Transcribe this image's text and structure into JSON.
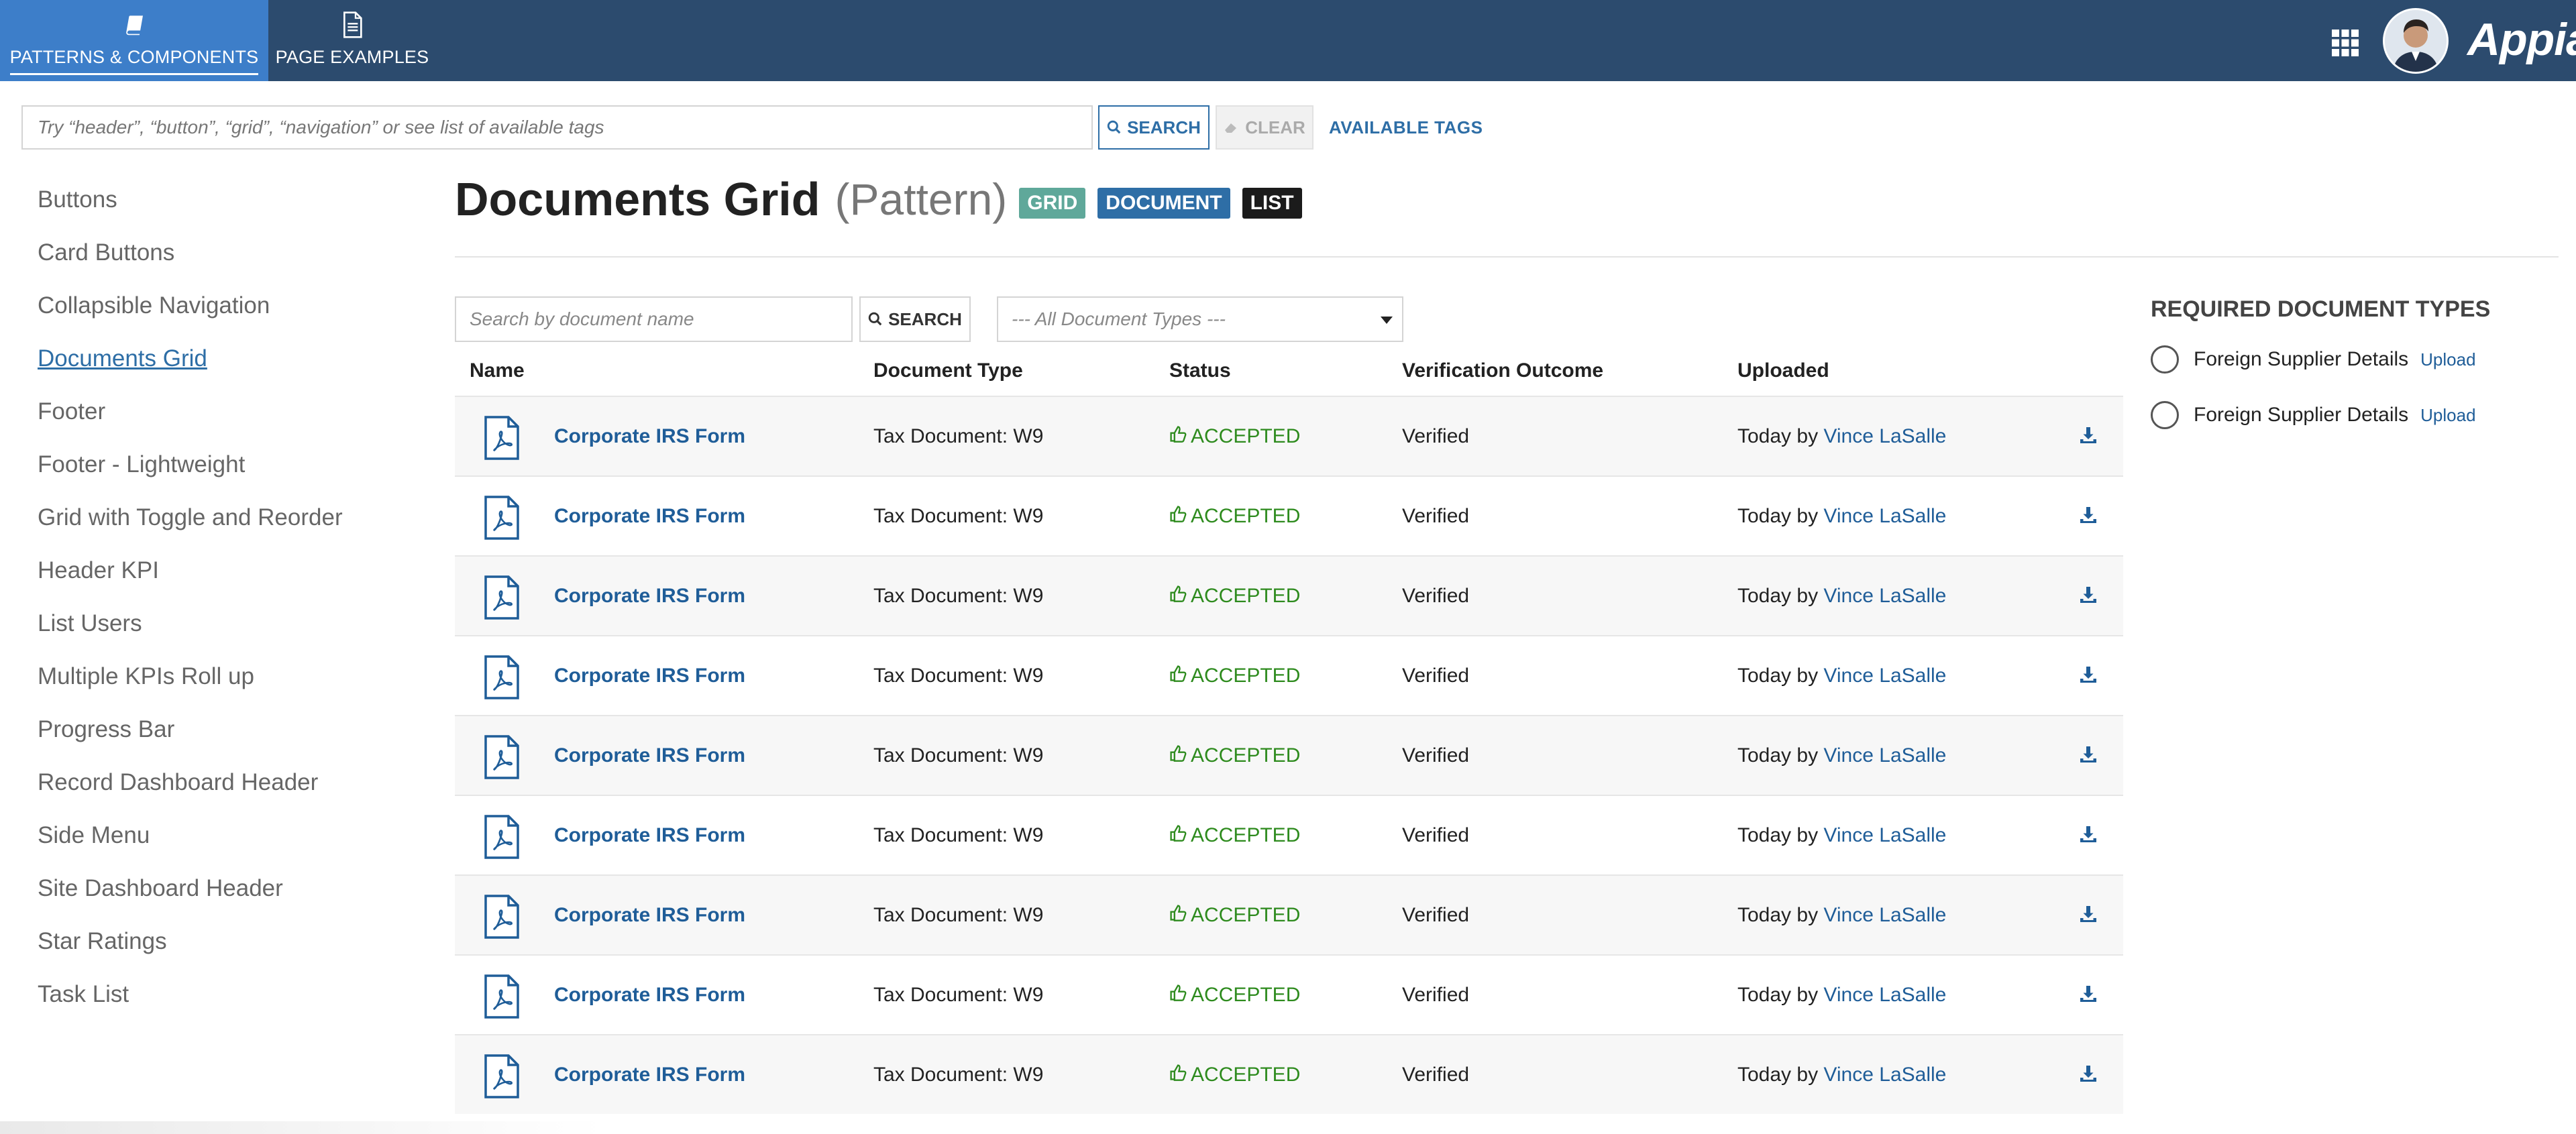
{
  "topnav": {
    "tabs": [
      {
        "label": "PATTERNS & COMPONENTS",
        "icon": "book-icon",
        "active": true
      },
      {
        "label": "PAGE EXAMPLES",
        "icon": "page-icon",
        "active": false
      }
    ],
    "logo": "Appian"
  },
  "tag_search": {
    "placeholder": "Try “header”, “button”, “grid”, “navigation” or see list of available tags",
    "search_label": "SEARCH",
    "clear_label": "CLEAR",
    "available_tags_label": "AVAILABLE TAGS"
  },
  "sidebar": {
    "items": [
      {
        "label": "Buttons"
      },
      {
        "label": "Card Buttons"
      },
      {
        "label": "Collapsible Navigation"
      },
      {
        "label": "Documents Grid",
        "active": true
      },
      {
        "label": "Footer"
      },
      {
        "label": "Footer - Lightweight"
      },
      {
        "label": "Grid with Toggle and Reorder"
      },
      {
        "label": "Header KPI"
      },
      {
        "label": "List Users"
      },
      {
        "label": "Multiple KPIs Roll up"
      },
      {
        "label": "Progress Bar"
      },
      {
        "label": "Record Dashboard Header"
      },
      {
        "label": "Side Menu"
      },
      {
        "label": "Site Dashboard Header"
      },
      {
        "label": "Star Ratings"
      },
      {
        "label": "Task List"
      }
    ]
  },
  "header": {
    "title": "Documents Grid",
    "subtitle": "(Pattern)",
    "tags": [
      {
        "label": "GRID",
        "color": "#5fa89a"
      },
      {
        "label": "DOCUMENT",
        "color": "#2e6ea6"
      },
      {
        "label": "LIST",
        "color": "#1b1b1b"
      }
    ]
  },
  "doc_search": {
    "placeholder": "Search by document name",
    "search_label": "SEARCH",
    "type_select_value": "--- All Document Types ---"
  },
  "grid": {
    "columns": [
      "Name",
      "Document Type",
      "Status",
      "Verification Outcome",
      "Uploaded"
    ],
    "rows": [
      {
        "name": "Corporate IRS Form",
        "type": "Tax Document: W9",
        "status": "ACCEPTED",
        "outcome": "Verified",
        "uploaded_prefix": "Today by",
        "user": "Vince LaSalle"
      },
      {
        "name": "Corporate IRS Form",
        "type": "Tax Document: W9",
        "status": "ACCEPTED",
        "outcome": "Verified",
        "uploaded_prefix": "Today by",
        "user": "Vince LaSalle"
      },
      {
        "name": "Corporate IRS Form",
        "type": "Tax Document: W9",
        "status": "ACCEPTED",
        "outcome": "Verified",
        "uploaded_prefix": "Today by",
        "user": "Vince LaSalle"
      },
      {
        "name": "Corporate IRS Form",
        "type": "Tax Document: W9",
        "status": "ACCEPTED",
        "outcome": "Verified",
        "uploaded_prefix": "Today by",
        "user": "Vince LaSalle"
      },
      {
        "name": "Corporate IRS Form",
        "type": "Tax Document: W9",
        "status": "ACCEPTED",
        "outcome": "Verified",
        "uploaded_prefix": "Today by",
        "user": "Vince LaSalle"
      },
      {
        "name": "Corporate IRS Form",
        "type": "Tax Document: W9",
        "status": "ACCEPTED",
        "outcome": "Verified",
        "uploaded_prefix": "Today by",
        "user": "Vince LaSalle"
      },
      {
        "name": "Corporate IRS Form",
        "type": "Tax Document: W9",
        "status": "ACCEPTED",
        "outcome": "Verified",
        "uploaded_prefix": "Today by",
        "user": "Vince LaSalle"
      },
      {
        "name": "Corporate IRS Form",
        "type": "Tax Document: W9",
        "status": "ACCEPTED",
        "outcome": "Verified",
        "uploaded_prefix": "Today by",
        "user": "Vince LaSalle"
      },
      {
        "name": "Corporate IRS Form",
        "type": "Tax Document: W9",
        "status": "ACCEPTED",
        "outcome": "Verified",
        "uploaded_prefix": "Today by",
        "user": "Vince LaSalle"
      }
    ]
  },
  "required_docs": {
    "title": "REQUIRED DOCUMENT TYPES",
    "items": [
      {
        "label": "Foreign Supplier Details",
        "action": "Upload"
      },
      {
        "label": "Foreign Supplier Details",
        "action": "Upload"
      }
    ]
  },
  "colors": {
    "topbar": "#2c4b6e",
    "active_tab": "#3d7ec9",
    "link": "#1f5d98",
    "accepted": "#2e8b1e"
  }
}
